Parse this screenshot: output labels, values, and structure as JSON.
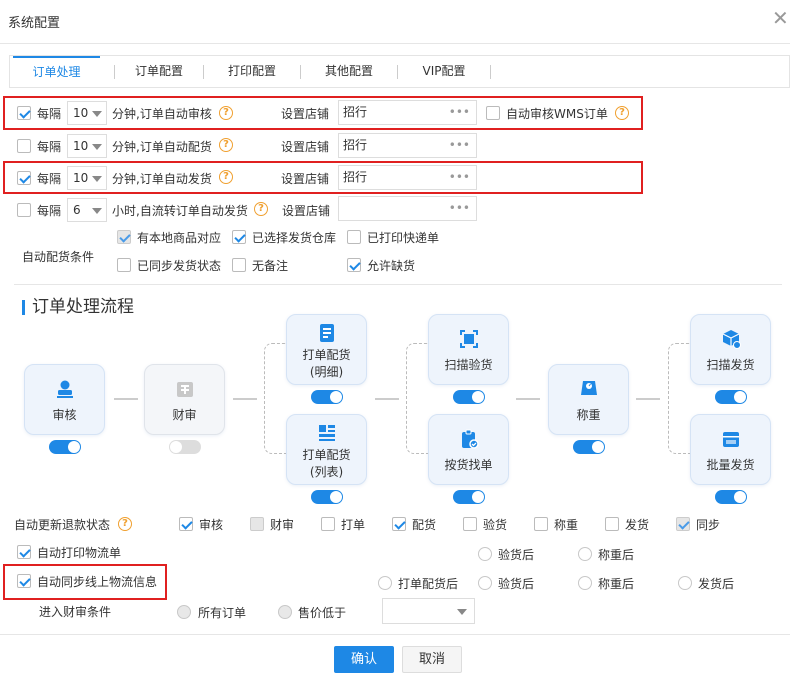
{
  "dialog": {
    "title": "系统配置",
    "close_icon": "close-icon"
  },
  "tabs": [
    "订单处理",
    "订单配置",
    "打印配置",
    "其他配置",
    "VIP配置"
  ],
  "auto_rows": [
    {
      "checked": true,
      "every": "每隔",
      "value": "10",
      "desc": "分钟,订单自动审核",
      "shop_label": "设置店铺",
      "shop": "招行",
      "extra_label": "自动审核WMS订单",
      "extra_checked": false
    },
    {
      "checked": false,
      "every": "每隔",
      "value": "10",
      "desc": "分钟,订单自动配货",
      "shop_label": "设置店铺",
      "shop": "招行"
    },
    {
      "checked": true,
      "every": "每隔",
      "value": "10",
      "desc": "分钟,订单自动发货",
      "shop_label": "设置店铺",
      "shop": "招行"
    },
    {
      "checked": false,
      "every": "每隔",
      "value": "6",
      "desc": "小时,自流转订单自动发货",
      "shop_label": "设置店铺",
      "shop": ""
    }
  ],
  "dots": "•••",
  "allocation": {
    "label": "自动配货条件",
    "options": [
      {
        "label": "有本地商品对应",
        "checked": true,
        "disabled": true
      },
      {
        "label": "已选择发货仓库",
        "checked": true,
        "disabled": false
      },
      {
        "label": "已打印快递单",
        "checked": false,
        "disabled": false
      },
      {
        "label": "已同步发货状态",
        "checked": false,
        "disabled": false
      },
      {
        "label": "无备注",
        "checked": false,
        "disabled": false
      },
      {
        "label": "允许缺货",
        "checked": true,
        "disabled": false
      }
    ]
  },
  "flow": {
    "title": "订单处理流程",
    "steps": {
      "audit": {
        "label": "审核",
        "on": true
      },
      "finance": {
        "label": "财审",
        "on": false
      },
      "print_detail": {
        "label": "打单配货\n(明细)",
        "on": true
      },
      "print_list": {
        "label": "打单配货\n(列表)",
        "on": true
      },
      "scan_check": {
        "label": "扫描验货",
        "on": true
      },
      "pick_by_goods": {
        "label": "按货找单",
        "on": true
      },
      "weigh": {
        "label": "称重",
        "on": true
      },
      "scan_ship": {
        "label": "扫描发货",
        "on": true
      },
      "batch_ship": {
        "label": "批量发货",
        "on": true
      }
    }
  },
  "refund": {
    "label": "自动更新退款状态",
    "options": [
      {
        "label": "审核",
        "checked": true,
        "disabled": false
      },
      {
        "label": "财审",
        "checked": false,
        "disabled": true
      },
      {
        "label": "打单",
        "checked": false,
        "disabled": false
      },
      {
        "label": "配货",
        "checked": true,
        "disabled": false
      },
      {
        "label": "验货",
        "checked": false,
        "disabled": false
      },
      {
        "label": "称重",
        "checked": false,
        "disabled": false
      },
      {
        "label": "发货",
        "checked": false,
        "disabled": false
      },
      {
        "label": "同步",
        "checked": true,
        "disabled": true
      }
    ]
  },
  "auto_print_logistics": {
    "label": "自动打印物流单",
    "checked": true,
    "radios": [
      "验货后",
      "称重后"
    ]
  },
  "auto_sync_logistics": {
    "label": "自动同步线上物流信息",
    "checked": true,
    "radios": [
      "打单配货后",
      "验货后",
      "称重后",
      "发货后"
    ]
  },
  "finance_condition": {
    "label": "进入财审条件",
    "radios": [
      "所有订单",
      "售价低于"
    ],
    "select_value": ""
  },
  "footer": {
    "confirm": "确认",
    "cancel": "取消"
  }
}
